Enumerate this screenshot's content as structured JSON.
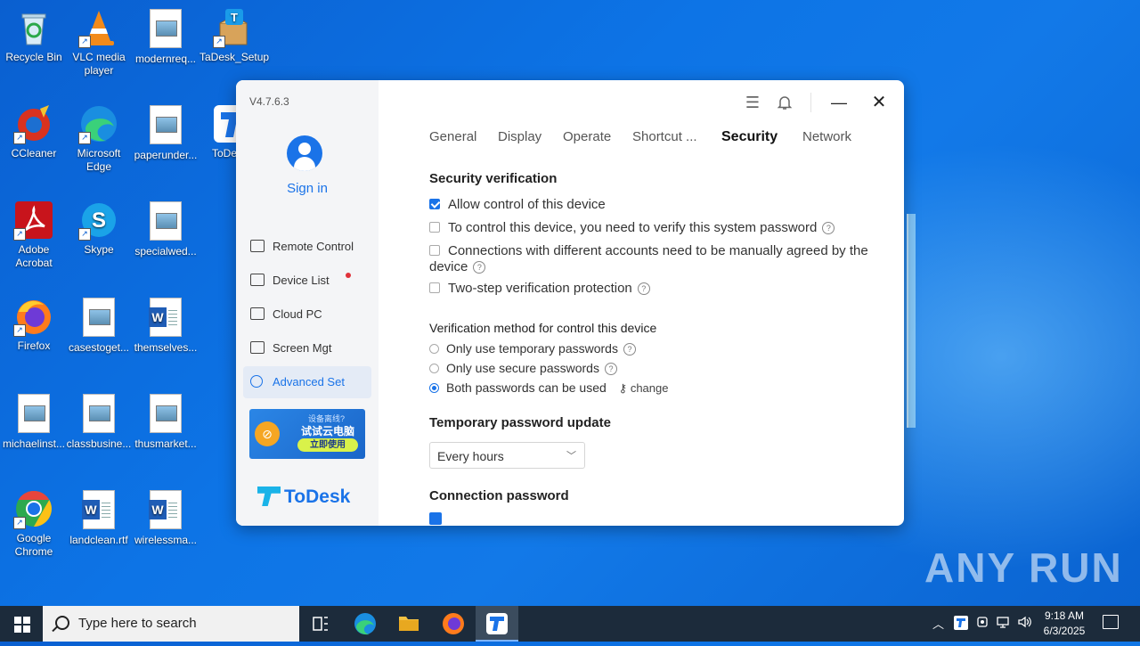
{
  "desktop": {
    "icons": [
      {
        "label": "Recycle Bin"
      },
      {
        "label": "VLC media player"
      },
      {
        "label": "modernreq..."
      },
      {
        "label": "TaDesk_Setup"
      },
      {
        "label": "CCleaner"
      },
      {
        "label": "Microsoft Edge"
      },
      {
        "label": "paperunder..."
      },
      {
        "label": "ToDe"
      },
      {
        "label": "Adobe Acrobat"
      },
      {
        "label": "Skype"
      },
      {
        "label": "specialwed..."
      },
      {
        "label": "Firefox"
      },
      {
        "label": "casestoget..."
      },
      {
        "label": "themselves..."
      },
      {
        "label": "michaelinst..."
      },
      {
        "label": "classbusine..."
      },
      {
        "label": "thusmarket..."
      },
      {
        "label": "Google Chrome"
      },
      {
        "label": "landclean.rtf"
      },
      {
        "label": "wirelessma..."
      }
    ],
    "watermark": "ANY RUN"
  },
  "app": {
    "version": "V4.7.6.3",
    "sign_in": "Sign in",
    "nav": [
      {
        "label": "Remote Control"
      },
      {
        "label": "Device List"
      },
      {
        "label": "Cloud PC"
      },
      {
        "label": "Screen Mgt"
      },
      {
        "label": "Advanced Set"
      }
    ],
    "promo": {
      "line1": "设备离线?",
      "line2": "试试云电脑",
      "button": "立即使用"
    },
    "brand": "ToDesk",
    "tabs": [
      "General",
      "Display",
      "Operate",
      "Shortcut ...",
      "Security",
      "Network"
    ],
    "active_tab": "Security",
    "security_verification": {
      "title": "Security verification",
      "options": [
        {
          "label": "Allow control of this device",
          "checked": true
        },
        {
          "label": "To control this device, you need to verify this system password",
          "checked": false
        },
        {
          "label": "Connections with different accounts need to be manually agreed by the device",
          "checked": false
        },
        {
          "label": "Two-step verification protection",
          "checked": false
        }
      ]
    },
    "verification_method": {
      "title": "Verification method for control this device",
      "options": [
        {
          "label": "Only use temporary passwords",
          "selected": false
        },
        {
          "label": "Only use secure passwords",
          "selected": false
        },
        {
          "label": "Both passwords can be used",
          "selected": true
        }
      ],
      "change_label": "change"
    },
    "temp_password": {
      "title": "Temporary password update",
      "selected": "Every hours"
    },
    "connection_password": {
      "title": "Connection password"
    }
  },
  "taskbar": {
    "search_placeholder": "Type here to search",
    "time": "9:18 AM",
    "date": "6/3/2025"
  },
  "colors": {
    "accent": "#1a73e8",
    "desktop": "#0d74e6",
    "taskbar": "#1c2b3b"
  }
}
